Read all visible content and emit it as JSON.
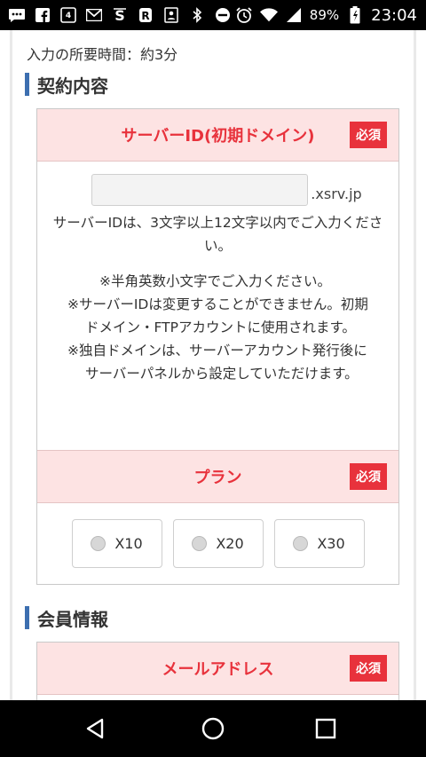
{
  "status_bar": {
    "battery_percent": "89%",
    "time": "23:04",
    "icons": [
      "messages-icon",
      "facebook-icon",
      "dmm-app-icon",
      "gmail-icon",
      "s-app-icon",
      "r-app-icon",
      "contacts-icon",
      "bluetooth-icon",
      "dnd-icon",
      "alarm-icon",
      "wifi-icon",
      "signal-icon",
      "battery-icon"
    ]
  },
  "time_note": "入力の所要時間：約3分",
  "section_contract": {
    "title": "契約内容",
    "server_id": {
      "label": "サーバーID(初期ドメイン)",
      "required": "必須",
      "input_value": "",
      "suffix": ".xsrv.jp",
      "rule": "サーバーIDは、3文字以上12文字以内でご入力ください。",
      "notes": [
        "※半角英数小文字でご入力ください。",
        "※サーバーIDは変更することができません。初期ドメイン・FTPアカウントに使用されます。",
        "※独自ドメインは、サーバーアカウント発行後にサーバーパネルから設定していただけます。"
      ]
    },
    "plan": {
      "label": "プラン",
      "required": "必須",
      "options": [
        "X10",
        "X20",
        "X30"
      ],
      "selected": null
    }
  },
  "section_member": {
    "title": "会員情報",
    "email": {
      "label": "メールアドレス",
      "required": "必須"
    }
  },
  "nav_bar": {
    "buttons": [
      "back",
      "home",
      "recents"
    ]
  },
  "colors": {
    "accent_red": "#e8323c",
    "header_pink": "#fde3e3",
    "section_bar_blue": "#3d6fb0"
  }
}
